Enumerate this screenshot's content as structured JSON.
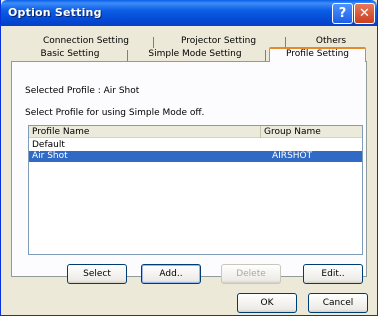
{
  "window": {
    "title": "Option Setting",
    "help_glyph": "?",
    "close_glyph": "✕"
  },
  "tabs": {
    "row1": [
      "Connection Setting",
      "Projector Setting",
      "Others"
    ],
    "row2": [
      "Basic Setting",
      "Simple Mode Setting",
      "Profile Setting"
    ],
    "active": "Profile Setting"
  },
  "profile": {
    "selected_label": "Selected Profile : Air Shot",
    "instruction": "Select Profile for using Simple Mode off.",
    "columns": [
      "Profile Name",
      "Group Name"
    ],
    "rows": [
      {
        "name": "Default",
        "group": ""
      },
      {
        "name": "Air Shot",
        "group": "AIRSHOT",
        "selected": true
      }
    ]
  },
  "buttons": {
    "select": "Select",
    "add": "Add..",
    "delete": "Delete",
    "edit": "Edit..",
    "ok": "OK",
    "cancel": "Cancel"
  },
  "colors": {
    "titlebar": "#0a5fe8",
    "selection": "#316ac5",
    "active_tab_accent": "#e68b2c"
  }
}
